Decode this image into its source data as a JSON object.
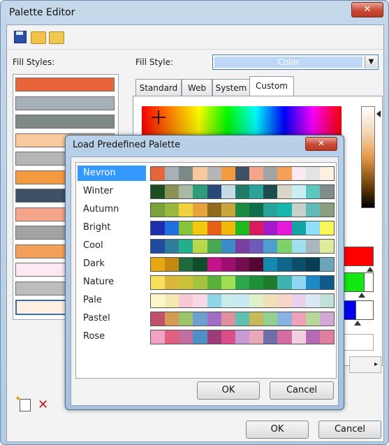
{
  "window": {
    "title": "Palette Editor",
    "close_label": "✕"
  },
  "toolbar": {
    "icons": [
      "save-icon",
      "open-folder-icon",
      "open-palette-icon"
    ]
  },
  "labels": {
    "fill_styles": "Fill Styles:",
    "fill_style": "Fill Style:"
  },
  "fill_style_combo": {
    "value": "Color"
  },
  "fill_styles_list": [
    "#e8643a",
    "#a7b0b8",
    "#7d8a86",
    "#f8c99d",
    "#b6b6b6",
    "#f59b3f",
    "#3f5166",
    "#f5a58a",
    "#a3a3a3",
    "#f5a05a",
    "#fbe8f2",
    "#bdbdbd",
    "#fef0e0"
  ],
  "tabs": [
    {
      "label": "Standard",
      "active": false
    },
    {
      "label": "Web",
      "active": false
    },
    {
      "label": "System",
      "active": false
    },
    {
      "label": "Custom",
      "active": true
    }
  ],
  "buttons": {
    "ok": "OK",
    "cancel": "Cancel"
  },
  "dialog": {
    "title": "Load Predefined Palette",
    "close_label": "✕",
    "ok": "OK",
    "cancel": "Cancel",
    "selected": "Nevron",
    "palettes": [
      {
        "name": "Nevron",
        "colors": [
          "#e8643a",
          "#a7b0b8",
          "#7d8a86",
          "#f8c99d",
          "#b6b6b6",
          "#f59b3f",
          "#3f5166",
          "#f5a58a",
          "#a3a3a3",
          "#f5a05a",
          "#fbe8f2",
          "#e3e3e3",
          "#fef0e0"
        ]
      },
      {
        "name": "Winter",
        "colors": [
          "#1d4d22",
          "#8c9155",
          "#a8b9a6",
          "#2e9c7a",
          "#274a78",
          "#c4dbe3",
          "#1f7a66",
          "#2aa39a",
          "#1e4d4d",
          "#d9d6c7",
          "#c8eef6",
          "#5fc6c0",
          "#7f8c8a"
        ]
      },
      {
        "name": "Autumn",
        "colors": [
          "#79a23a",
          "#98b83f",
          "#f0d23f",
          "#e8a33c",
          "#916a22",
          "#c9a53a",
          "#1b8b3f",
          "#0c6e4a",
          "#27a39a",
          "#19b6b0",
          "#c7d0c9",
          "#62bcb5",
          "#8b9f82"
        ]
      },
      {
        "name": "Bright",
        "colors": [
          "#1c2db0",
          "#1f6fe0",
          "#86c43a",
          "#f2c90f",
          "#e56117",
          "#f0b90c",
          "#1cb91f",
          "#da1a5c",
          "#a31acc",
          "#e51ad8",
          "#12a4a4",
          "#8de0f7",
          "#f7f75a"
        ]
      },
      {
        "name": "Cool",
        "colors": [
          "#1f4aa0",
          "#2e7d9c",
          "#21b08a",
          "#b8d84a",
          "#49a852",
          "#3a8bc7",
          "#7a3ea0",
          "#6e5ab8",
          "#4d9fcf",
          "#7cd36a",
          "#9fdff0",
          "#a9b6bf",
          "#ddeb9a"
        ]
      },
      {
        "name": "Dark",
        "colors": [
          "#e8a813",
          "#c48a0f",
          "#1e6a3a",
          "#0f4c2a",
          "#c4128c",
          "#9e0e6e",
          "#710e50",
          "#520830",
          "#148ab0",
          "#0f6688",
          "#0b4f6a",
          "#0a3e52",
          "#6aa5b8"
        ]
      },
      {
        "name": "Nature",
        "colors": [
          "#f6e05c",
          "#d9b83c",
          "#c9c23a",
          "#a7c23e",
          "#57b13b",
          "#9ee04f",
          "#2ea64b",
          "#1e8f3a",
          "#1f7a2a",
          "#3fb3b0",
          "#8fd7f0",
          "#1d89c6",
          "#0f5a8a"
        ]
      },
      {
        "name": "Pale",
        "colors": [
          "#fbf7c8",
          "#f3e9b1",
          "#f7c8d6",
          "#f7d9e6",
          "#91d6e8",
          "#c8ede9",
          "#c7e9f4",
          "#e0f0c8",
          "#f0e0b8",
          "#f7d6c8",
          "#e8d0ee",
          "#d8e8f4",
          "#c0e0d8"
        ]
      },
      {
        "name": "Pastel",
        "colors": [
          "#c0506b",
          "#d79a53",
          "#9cc26a",
          "#6a9fd0",
          "#a26dc4",
          "#e08f9f",
          "#62c0b3",
          "#c7b85a",
          "#90d090",
          "#8ab2e0",
          "#f0a0b8",
          "#b8d89a",
          "#d2a9d4"
        ]
      },
      {
        "name": "Rose",
        "colors": [
          "#f2a3c4",
          "#e0607f",
          "#c06fa0",
          "#4e8fc8",
          "#9c3d79",
          "#d94f8a",
          "#c79ad6",
          "#e8a8b8",
          "#6e6ea8",
          "#d46ca3",
          "#f2cfe0",
          "#b46bb4",
          "#e07fa0"
        ]
      }
    ]
  }
}
